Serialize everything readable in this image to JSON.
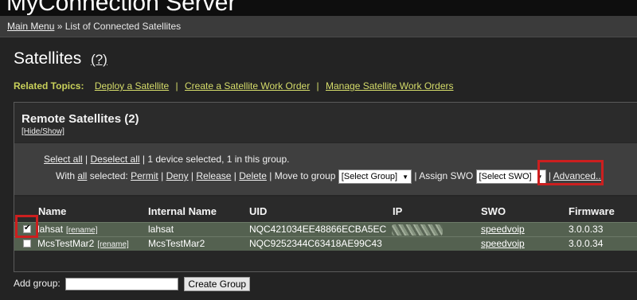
{
  "app": {
    "title": "MyConnection Server"
  },
  "breadcrumb": {
    "main": "Main Menu",
    "sep": "»",
    "current": "List of Connected Satellites"
  },
  "page": {
    "title": "Satellites",
    "help": "(?)"
  },
  "related": {
    "label": "Related Topics:",
    "sep": "|",
    "links": [
      "Deploy a Satellite",
      "Create a Satellite Work Order",
      "Manage Satellite Work Orders"
    ]
  },
  "panel": {
    "title": "Remote Satellites (2)",
    "hide_show": "[Hide/Show]",
    "select_all": "Select all",
    "deselect_all": "Deselect all",
    "sep": "|",
    "selection_status": "1 device selected, 1 in this group.",
    "with_prefix": "With",
    "with_all": "all",
    "with_suffix": "selected:",
    "permit": "Permit",
    "deny": "Deny",
    "release": "Release",
    "delete": "Delete",
    "move_to_group": "Move to group",
    "group_select": "[Select Group]",
    "assign_swo": "Assign SWO",
    "swo_select": "[Select SWO]",
    "advanced": "Advanced..."
  },
  "table": {
    "headers": {
      "name": "Name",
      "internal": "Internal Name",
      "uid": "UID",
      "ip": "IP",
      "swo": "SWO",
      "firmware": "Firmware"
    },
    "rename_label": "[rename]",
    "rows": [
      {
        "checked": true,
        "name": "lahsat",
        "internal": "lahsat",
        "uid": "NQC421034EE48866ECBA5EC",
        "swo": "speedvoip",
        "firmware": "3.0.0.33"
      },
      {
        "checked": false,
        "name": "McsTestMar2",
        "internal": "McsTestMar2",
        "uid": "NQC9252344C63418AE99C43",
        "swo": "speedvoip",
        "firmware": "3.0.0.34"
      }
    ]
  },
  "add_group": {
    "label": "Add group:",
    "value": "",
    "button": "Create Group"
  },
  "colors": {
    "highlight": "#cc1f1f",
    "related_link": "#d6dd6a",
    "row_bg": "#546150"
  }
}
